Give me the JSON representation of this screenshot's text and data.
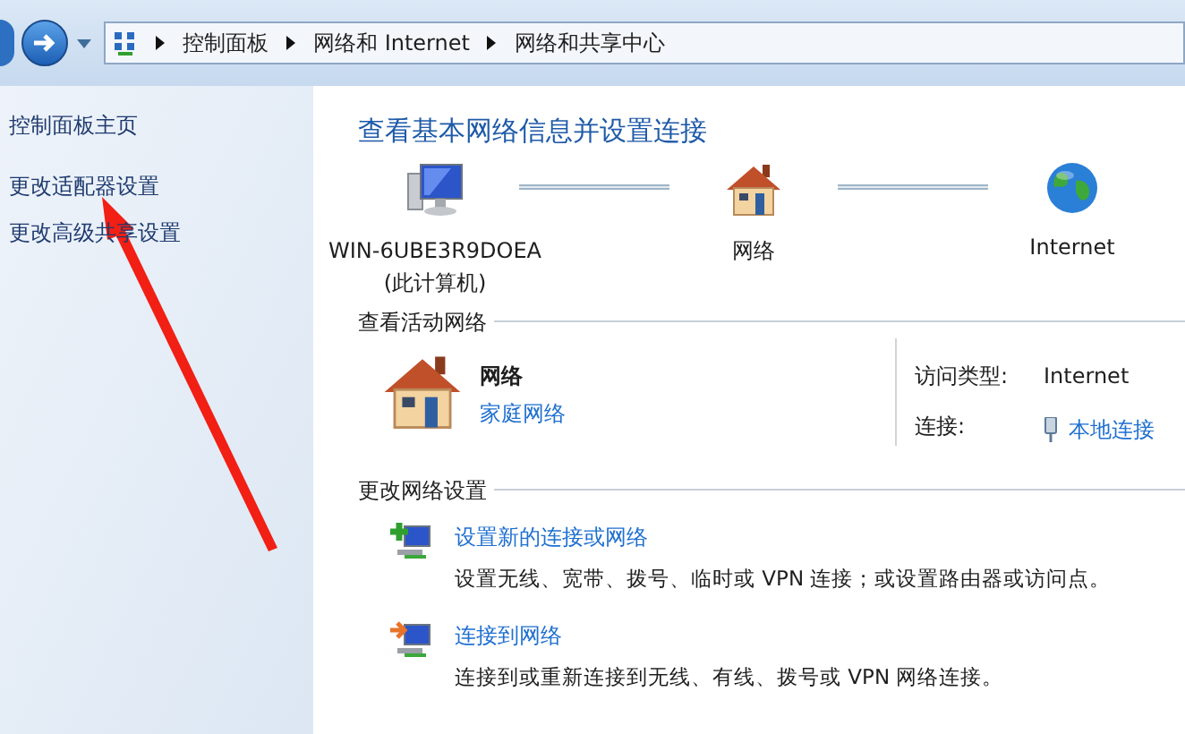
{
  "breadcrumb": [
    "控制面板",
    "网络和 Internet",
    "网络和共享中心"
  ],
  "sidebar": {
    "items": [
      {
        "label": "控制面板主页"
      },
      {
        "label": "更改适配器设置"
      },
      {
        "label": "更改高级共享设置"
      }
    ]
  },
  "title": "查看基本网络信息并设置连接",
  "network_map": [
    {
      "kind": "computer",
      "label": "WIN-6UBE3R9DOEA",
      "sublabel": "(此计算机)"
    },
    {
      "kind": "house",
      "label": "网络"
    },
    {
      "kind": "globe",
      "label": "Internet"
    }
  ],
  "active_networks": {
    "heading": "查看活动网络",
    "name": "网络",
    "type_link": "家庭网络",
    "access_label": "访问类型:",
    "access_value": "Internet",
    "connection_label": "连接:",
    "connection_link": "本地连接"
  },
  "change_settings": {
    "heading": "更改网络设置",
    "tasks": [
      {
        "kind": "new",
        "link": "设置新的连接或网络",
        "description": "设置无线、宽带、拨号、临时或 VPN 连接；或设置路由器或访问点。"
      },
      {
        "kind": "connect",
        "link": "连接到网络",
        "description": "连接到或重新连接到无线、有线、拨号或 VPN 网络连接。"
      }
    ]
  }
}
